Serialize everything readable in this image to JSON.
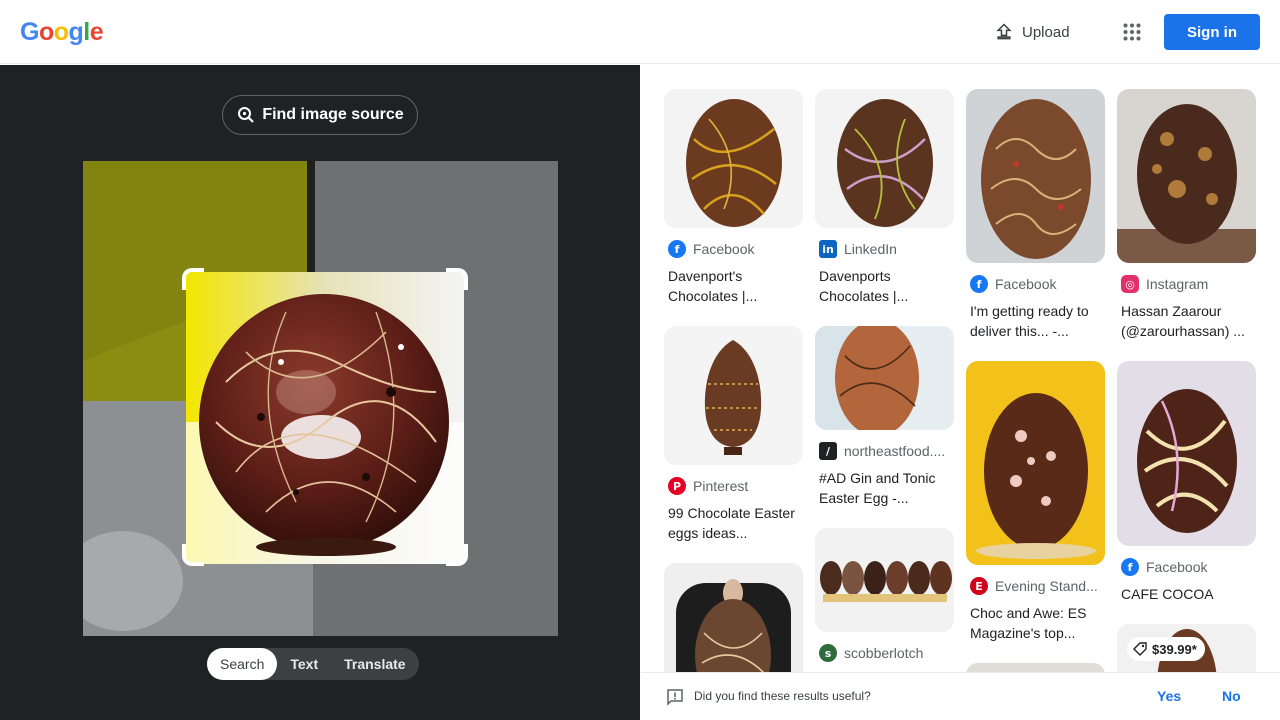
{
  "header": {
    "logo_letters": [
      "G",
      "o",
      "o",
      "g",
      "l",
      "e"
    ],
    "logo_colors": [
      "#4285F4",
      "#EA4335",
      "#FBBC05",
      "#4285F4",
      "#34A853",
      "#EA4335"
    ],
    "upload_label": "Upload",
    "apps_icon": "apps-grid-icon",
    "signin_label": "Sign in"
  },
  "lens": {
    "find_source_label": "Find image source",
    "tabs": [
      {
        "label": "Search",
        "active": true
      },
      {
        "label": "Text",
        "active": false
      },
      {
        "label": "Translate",
        "active": false
      }
    ]
  },
  "results": [
    {
      "source": "Facebook",
      "icon": "facebook-icon",
      "caption": "Davenport's Chocolates |..."
    },
    {
      "source": "LinkedIn",
      "icon": "linkedin-icon",
      "caption": "Davenports Chocolates |..."
    },
    {
      "source": "Facebook",
      "icon": "facebook-icon",
      "caption": "I'm getting ready to deliver this... -..."
    },
    {
      "source": "Instagram",
      "icon": "instagram-icon",
      "caption": "Hassan Zaarour (@zarourhassan) ..."
    },
    {
      "source": "Pinterest",
      "icon": "pinterest-icon",
      "caption": "99 Chocolate Easter eggs ideas..."
    },
    {
      "source": "northeastfood....",
      "icon": "northeastfood-icon",
      "caption": "#AD Gin and Tonic Easter Egg -..."
    },
    {
      "source": "Evening Stand...",
      "icon": "evening-standard-icon",
      "caption": "Choc and Awe: ES Magazine's top..."
    },
    {
      "source": "Facebook",
      "icon": "facebook-icon",
      "caption": "CAFE COCOA"
    },
    {
      "source": "scobberlotch",
      "icon": "scobberlotch-icon",
      "caption": ""
    }
  ],
  "price_badge": "$39.99*",
  "feedback": {
    "question": "Did you find these results useful?",
    "yes_label": "Yes",
    "no_label": "No"
  },
  "colors": {
    "accent": "#1a73e8",
    "dark_panel": "#202124",
    "facebook": "#1877F2",
    "linkedin": "#0A66C2",
    "pinterest": "#E60023",
    "instagram": "#E1306C"
  }
}
